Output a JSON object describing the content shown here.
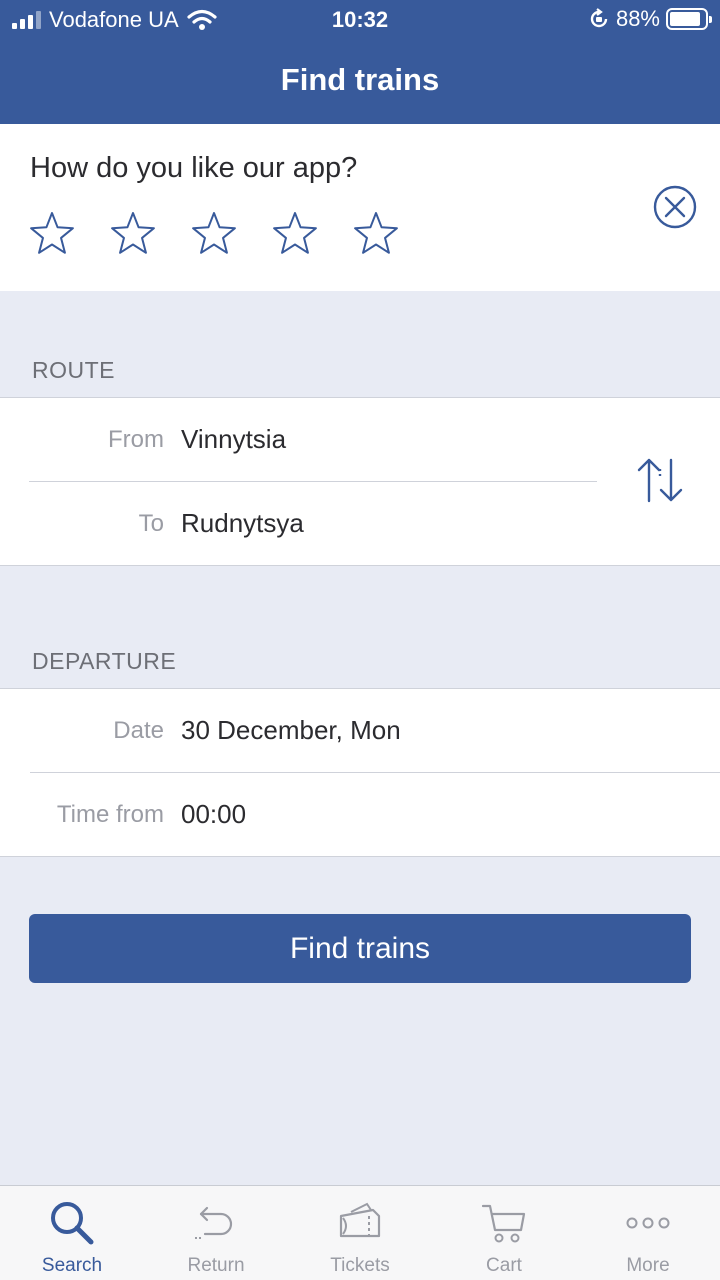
{
  "status_bar": {
    "carrier": "Vodafone UA",
    "time": "10:32",
    "battery": "88%",
    "battery_level": 0.88
  },
  "nav": {
    "title": "Find trains"
  },
  "rating": {
    "question": "How do you like our app?",
    "stars_total": 5,
    "stars_selected": 0
  },
  "route": {
    "header": "ROUTE",
    "from_label": "From",
    "from_value": "Vinnytsia",
    "to_label": "To",
    "to_value": "Rudnytsya"
  },
  "departure": {
    "header": "DEPARTURE",
    "date_label": "Date",
    "date_value": "30 December, Mon",
    "time_label": "Time from",
    "time_value": "00:00"
  },
  "actions": {
    "find_trains": "Find trains"
  },
  "tabs": [
    {
      "label": "Search",
      "icon": "search-icon",
      "active": true
    },
    {
      "label": "Return",
      "icon": "return-icon",
      "active": false
    },
    {
      "label": "Tickets",
      "icon": "ticket-icon",
      "active": false
    },
    {
      "label": "Cart",
      "icon": "cart-icon",
      "active": false
    },
    {
      "label": "More",
      "icon": "more-icon",
      "active": false
    }
  ],
  "colors": {
    "brand": "#385a9b",
    "background": "#e8ebf4",
    "inactive": "#9a9ca4"
  }
}
